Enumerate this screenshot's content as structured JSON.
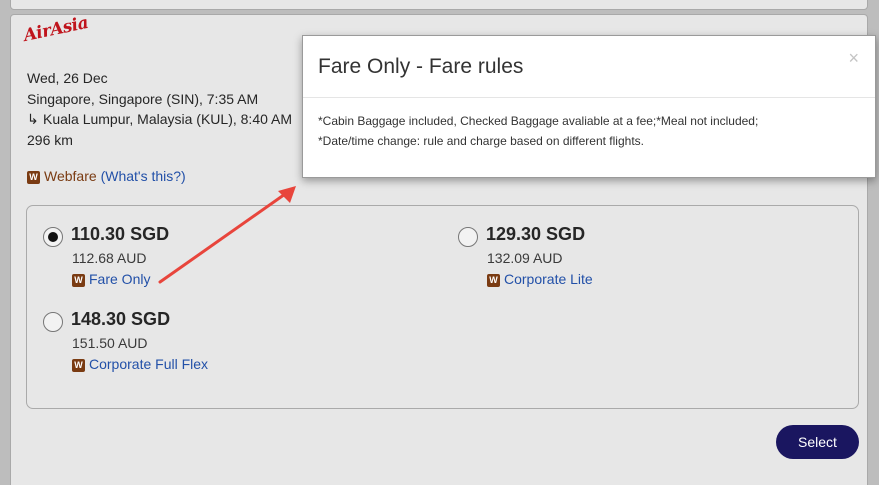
{
  "flight": {
    "airline_logo": "AirAsia",
    "date": "Wed, 26 Dec",
    "departure": "Singapore, Singapore (SIN), 7:35 AM",
    "arrival": "Kuala Lumpur, Malaysia (KUL), 8:40 AM",
    "distance": "296 km",
    "fare_type": "Webfare",
    "whats_this": "(What's this?)",
    "fare_badge": "W"
  },
  "fares": [
    {
      "price": "110.30 SGD",
      "alt_price": "112.68 AUD",
      "name": "Fare Only",
      "selected": true
    },
    {
      "price": "129.30 SGD",
      "alt_price": "132.09 AUD",
      "name": "Corporate Lite",
      "selected": false
    },
    {
      "price": "148.30 SGD",
      "alt_price": "151.50 AUD",
      "name": "Corporate Full Flex",
      "selected": false
    }
  ],
  "select_button": "Select",
  "modal": {
    "title": "Fare Only - Fare rules",
    "close": "×",
    "line1": "*Cabin Baggage included, Checked Baggage avaliable at a fee;*Meal not included;",
    "line2": "*Date/time change: rule and charge based on different flights."
  },
  "colors": {
    "accent_button": "#1a1660",
    "link": "#2250a8",
    "badge": "#7a3b12",
    "arrow": "#e8453c"
  }
}
